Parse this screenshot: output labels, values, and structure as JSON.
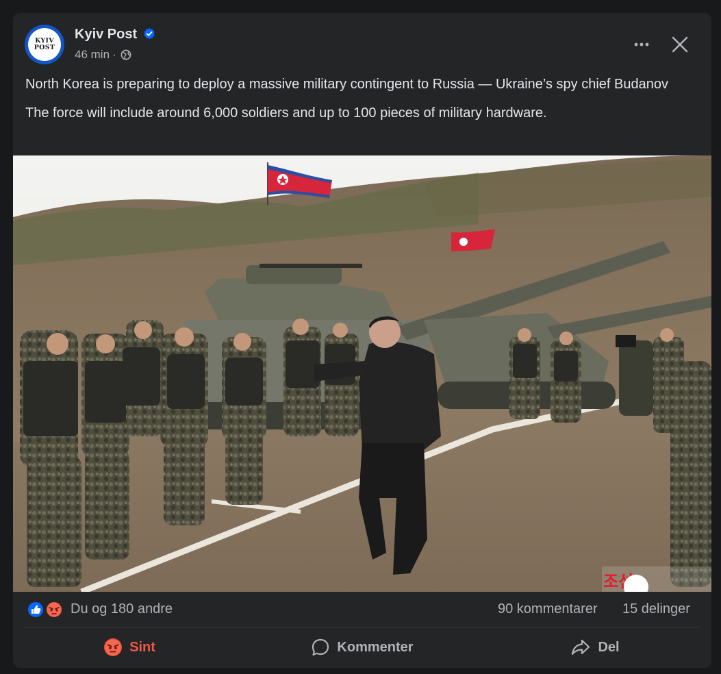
{
  "post": {
    "page_name": "Kyiv Post",
    "logo_text": [
      "KYIV",
      "POST"
    ],
    "time": "46 min",
    "meta_separator": "·",
    "headline": "North Korea is preparing to deploy a massive military contingent to Russia — Ukraine’s spy chief Budanov",
    "body": "The force will include around 6,000 soldiers and up to 100 pieces of military hardware.",
    "photo_watermark": "조선"
  },
  "stats": {
    "reactions_text": "Du og 180 andre",
    "comments_text": "90 kommentarer",
    "shares_text": "15 delinger"
  },
  "actions": {
    "reaction_label": "Sint",
    "comment_label": "Kommenter",
    "share_label": "Del"
  },
  "colors": {
    "background": "#18191a",
    "card": "#242526",
    "text_primary": "#e4e6eb",
    "text_secondary": "#b0b3b8",
    "verified_blue": "#0866ff",
    "angry_red": "#f0594a"
  },
  "icons": [
    "verified-badge-icon",
    "globe-icon",
    "more-icon",
    "close-icon",
    "like-reaction-icon",
    "angry-reaction-icon",
    "comment-icon",
    "share-icon"
  ]
}
